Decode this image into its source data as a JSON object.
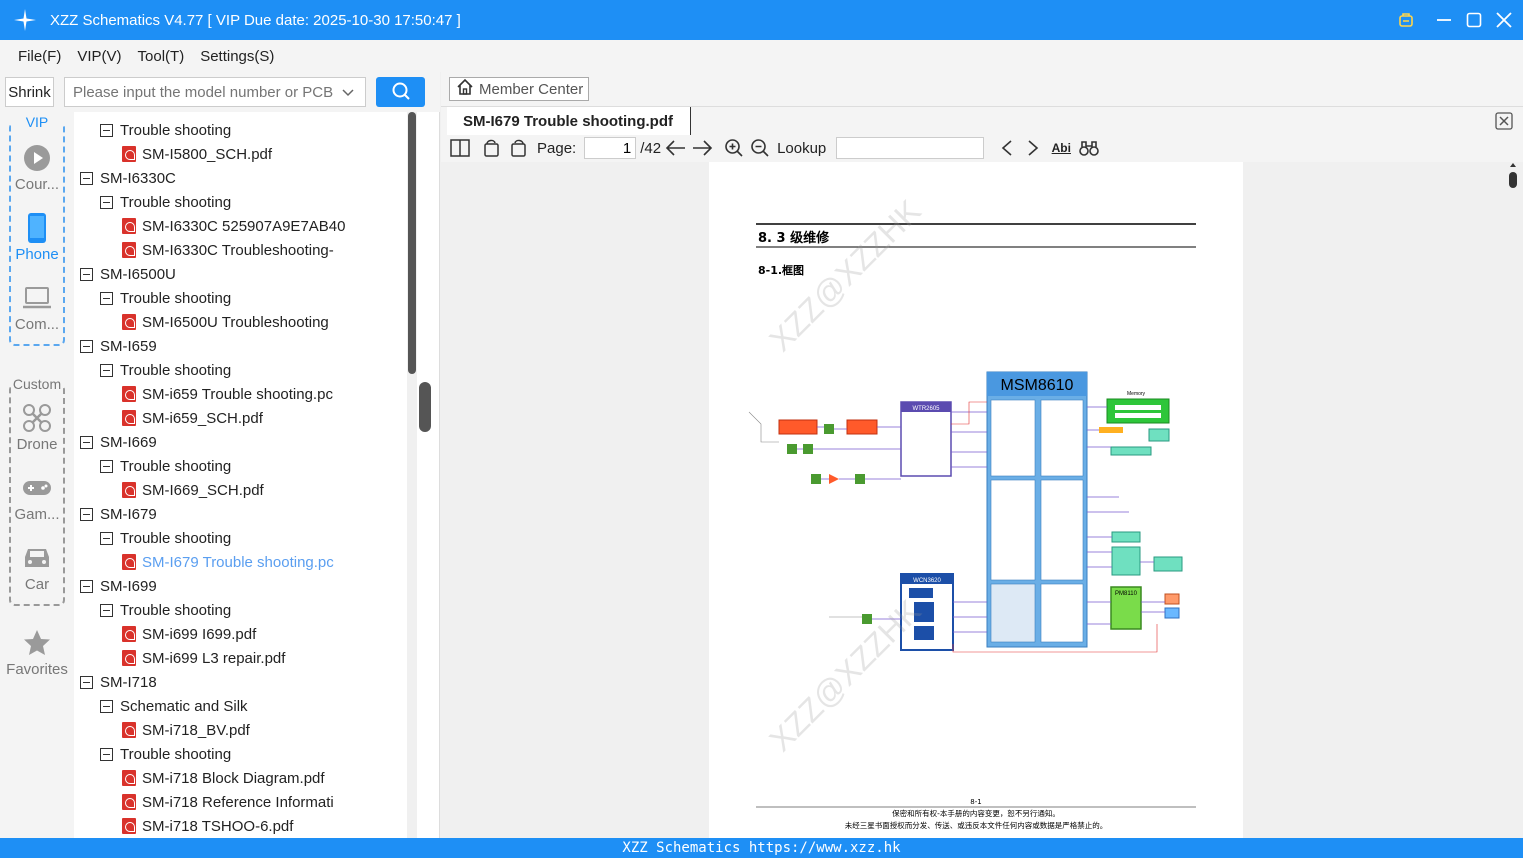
{
  "app": {
    "title": "XZZ Schematics V4.77 [ VIP Due date: 2025-10-30 17:50:47 ]"
  },
  "menu": [
    "File(F)",
    "VIP(V)",
    "Tool(T)",
    "Settings(S)"
  ],
  "search": {
    "shrink_label": "Shrink",
    "placeholder": "Please input the model number or PCB"
  },
  "sidebar": {
    "vip_label": "VIP",
    "custom_label": "Custom",
    "categories": [
      {
        "label": "Cour...",
        "icon": "play-icon"
      },
      {
        "label": "Phone",
        "icon": "phone-icon"
      },
      {
        "label": "Com...",
        "icon": "laptop-icon"
      },
      {
        "label": "Drone",
        "icon": "drone-icon"
      },
      {
        "label": "Gam...",
        "icon": "gamepad-icon"
      },
      {
        "label": "Car",
        "icon": "car-icon"
      },
      {
        "label": "Favorites",
        "icon": "star-icon"
      }
    ]
  },
  "tree": [
    {
      "level": 1,
      "type": "folder",
      "label": "Trouble shooting"
    },
    {
      "level": 2,
      "type": "pdf",
      "label": "SM-I5800_SCH.pdf"
    },
    {
      "level": 0,
      "type": "folder",
      "label": "SM-I6330C"
    },
    {
      "level": 1,
      "type": "folder",
      "label": "Trouble shooting"
    },
    {
      "level": 2,
      "type": "pdf",
      "label": "SM-I6330C 525907A9E7AB40"
    },
    {
      "level": 2,
      "type": "pdf",
      "label": "SM-I6330C Troubleshooting-"
    },
    {
      "level": 0,
      "type": "folder",
      "label": "SM-I6500U"
    },
    {
      "level": 1,
      "type": "folder",
      "label": "Trouble shooting"
    },
    {
      "level": 2,
      "type": "pdf",
      "label": "SM-I6500U Troubleshooting"
    },
    {
      "level": 0,
      "type": "folder",
      "label": "SM-I659"
    },
    {
      "level": 1,
      "type": "folder",
      "label": "Trouble shooting"
    },
    {
      "level": 2,
      "type": "pdf",
      "label": "SM-i659 Trouble shooting.pc"
    },
    {
      "level": 2,
      "type": "pdf",
      "label": "SM-i659_SCH.pdf"
    },
    {
      "level": 0,
      "type": "folder",
      "label": "SM-I669"
    },
    {
      "level": 1,
      "type": "folder",
      "label": "Trouble shooting"
    },
    {
      "level": 2,
      "type": "pdf",
      "label": "SM-I669_SCH.pdf"
    },
    {
      "level": 0,
      "type": "folder",
      "label": "SM-I679"
    },
    {
      "level": 1,
      "type": "folder",
      "label": "Trouble shooting"
    },
    {
      "level": 2,
      "type": "pdf",
      "label": "SM-I679 Trouble shooting.pc",
      "selected": true
    },
    {
      "level": 0,
      "type": "folder",
      "label": "SM-I699"
    },
    {
      "level": 1,
      "type": "folder",
      "label": "Trouble shooting"
    },
    {
      "level": 2,
      "type": "pdf",
      "label": "SM-i699 I699.pdf"
    },
    {
      "level": 2,
      "type": "pdf",
      "label": "SM-i699 L3 repair.pdf"
    },
    {
      "level": 0,
      "type": "folder",
      "label": "SM-I718"
    },
    {
      "level": 1,
      "type": "folder",
      "label": "Schematic and Silk"
    },
    {
      "level": 2,
      "type": "pdf",
      "label": "SM-i718_BV.pdf"
    },
    {
      "level": 1,
      "type": "folder",
      "label": "Trouble shooting"
    },
    {
      "level": 2,
      "type": "pdf",
      "label": "SM-i718 Block Diagram.pdf"
    },
    {
      "level": 2,
      "type": "pdf",
      "label": "SM-i718 Reference Informati"
    },
    {
      "level": 2,
      "type": "pdf",
      "label": "SM-i718 TSHOO-6.pdf"
    }
  ],
  "viewer": {
    "member_center": "Member Center",
    "doc_tab": "SM-I679 Trouble shooting.pdf",
    "page_label": "Page:",
    "page_value": "1",
    "page_total": "/42",
    "lookup_label": "Lookup",
    "abi_label": "Abi"
  },
  "document": {
    "heading": "8. 3 级维修",
    "subheading": "8-1.框图",
    "chip_main": "MSM8610",
    "chip_rf": "WTR2605",
    "chip_wlan": "WCN3620",
    "chip_pmic": "PM8110",
    "memory_label": "Memory",
    "page_number": "8-1",
    "footer_line1": "保密和所有权-本手册的内容变更，恕不另行通知。",
    "footer_line2": "未经三星书面授权而分发、传送、或违反本文件任何内容或数据是严格禁止的。",
    "watermark": "XZZ@XZZHK"
  },
  "status": {
    "text": "XZZ Schematics https://www.xzz.hk"
  },
  "colors": {
    "accent": "#1e8ff5",
    "selected_item": "#5a9ef0",
    "pdf_icon": "#d9322b"
  }
}
